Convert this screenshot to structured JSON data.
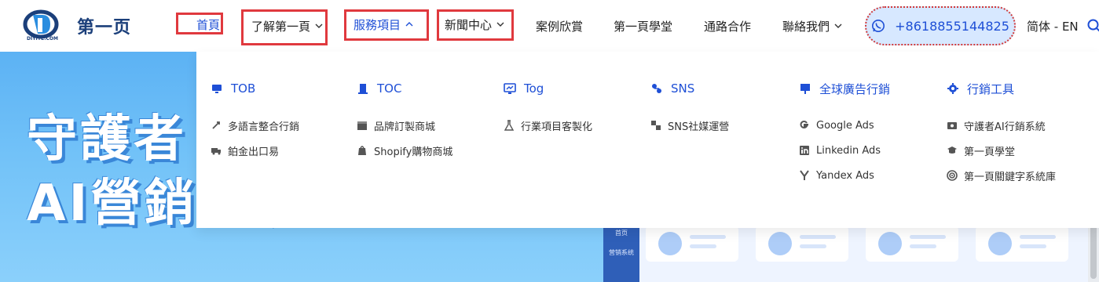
{
  "logo": {
    "name": "第一页",
    "sub": "DIYIYE.COM"
  },
  "nav": {
    "home": "首頁",
    "about": "了解第一頁",
    "services": "服務項目",
    "news": "新聞中心",
    "cases": "案例欣賞",
    "academy": "第一頁學堂",
    "channel": "通路合作",
    "contact": "聯絡我們"
  },
  "phone": "+8618855144825",
  "language": "简体 - EN",
  "dropdown": {
    "columns": [
      {
        "title": "TOB",
        "items": [
          "多語言整合行銷",
          "鉑金出口易"
        ]
      },
      {
        "title": "TOC",
        "items": [
          "品牌訂製商城",
          "Shopify購物商城"
        ]
      },
      {
        "title": "Tog",
        "items": [
          "行業項目客製化"
        ]
      },
      {
        "title": "SNS",
        "items": [
          "SNS社媒運營"
        ]
      },
      {
        "title": "全球廣告行銷",
        "items": [
          "Google Ads",
          "Linkedin Ads",
          "Yandex Ads"
        ]
      },
      {
        "title": "行銷工具",
        "items": [
          "守護者AI行銷系統",
          "第一頁學堂",
          "第一頁關鍵字系統庫"
        ]
      }
    ]
  },
  "hero": {
    "line1": "守護者",
    "line2": "AI營銷系統"
  },
  "mock": {
    "side1": "首页",
    "side2": "营销系统"
  },
  "colors": {
    "accent": "#1e4fd6",
    "highlight_box": "#e0393e",
    "hero_bg": "#72c2f8"
  }
}
